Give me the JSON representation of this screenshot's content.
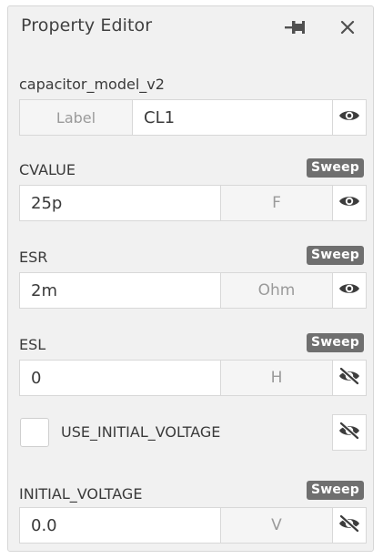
{
  "window": {
    "title": "Property Editor"
  },
  "model": {
    "name": "capacitor_model_v2",
    "label_tag": "Label",
    "label_value": "CL1"
  },
  "properties": [
    {
      "name": "CVALUE",
      "value": "25p",
      "unit": "F",
      "sweep": "Sweep",
      "visible": true
    },
    {
      "name": "ESR",
      "value": "2m",
      "unit": "Ohm",
      "sweep": "Sweep",
      "visible": true
    },
    {
      "name": "ESL",
      "value": "0",
      "unit": "H",
      "sweep": "Sweep",
      "visible": false
    }
  ],
  "use_initial_voltage": {
    "label": "USE_INITIAL_VOLTAGE",
    "checked": false,
    "visible": false
  },
  "initial_voltage": {
    "name": "INITIAL_VOLTAGE",
    "value": "0.0",
    "unit": "V",
    "sweep": "Sweep",
    "visible": false
  },
  "icons": {
    "pin": "pin-icon",
    "close": "close-icon",
    "eye": "eye-icon",
    "eye_hidden": "eye-slash-icon"
  }
}
